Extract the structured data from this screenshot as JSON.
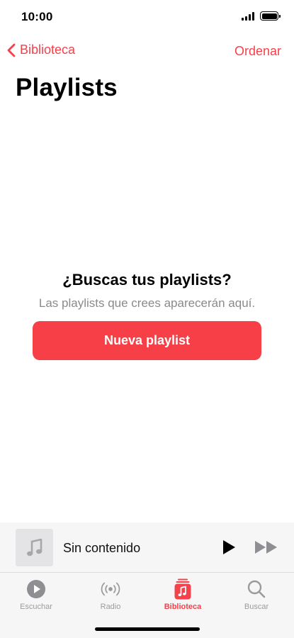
{
  "status_bar": {
    "time": "10:00"
  },
  "nav": {
    "back_label": "Biblioteca",
    "sort_label": "Ordenar"
  },
  "page": {
    "title": "Playlists"
  },
  "empty_state": {
    "title": "¿Buscas tus playlists?",
    "subtitle": "Las playlists que crees aparecerán aquí.",
    "button_label": "Nueva playlist"
  },
  "mini_player": {
    "track_title": "Sin contenido"
  },
  "tabs": [
    {
      "label": "Escuchar",
      "icon": "play-circle-icon",
      "active": false
    },
    {
      "label": "Radio",
      "icon": "radio-broadcast-icon",
      "active": false
    },
    {
      "label": "Biblioteca",
      "icon": "music-library-icon",
      "active": true
    },
    {
      "label": "Buscar",
      "icon": "search-icon",
      "active": false
    }
  ],
  "colors": {
    "accent": "#f4414b",
    "button": "#f73f48",
    "inactive": "#9b9b9e"
  }
}
